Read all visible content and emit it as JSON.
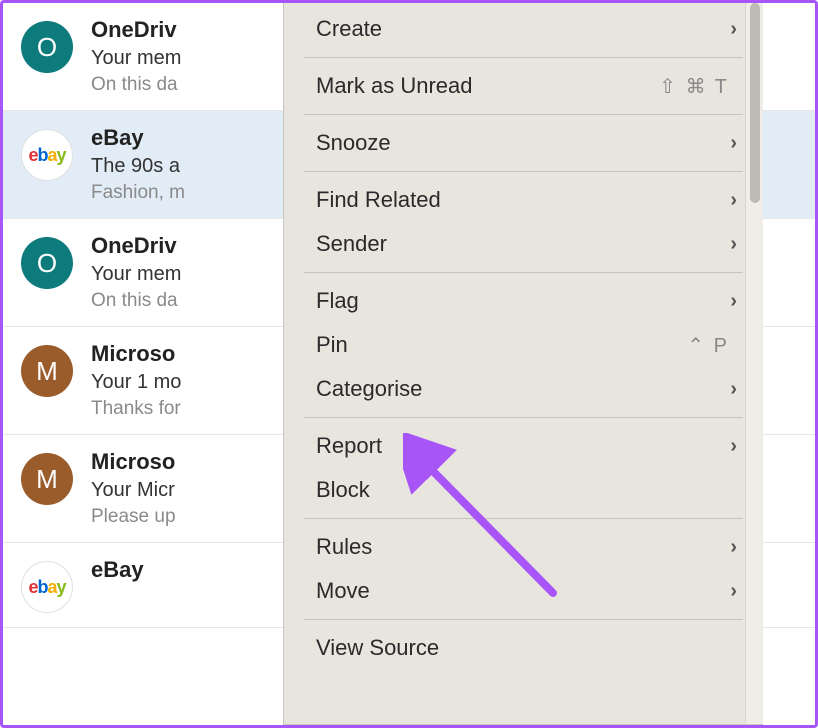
{
  "emails": [
    {
      "sender": "OneDriv",
      "avatarLetter": "O",
      "avatarClass": "teal",
      "subject": "Your mem",
      "preview": "On this da",
      "selected": false
    },
    {
      "sender": "eBay",
      "avatarLetter": "",
      "avatarClass": "ebay",
      "subject": "The 90s a",
      "preview": "Fashion, m",
      "selected": true
    },
    {
      "sender": "OneDriv",
      "avatarLetter": "O",
      "avatarClass": "teal",
      "subject": "Your mem",
      "preview": "On this da",
      "selected": false
    },
    {
      "sender": "Microso",
      "avatarLetter": "M",
      "avatarClass": "brown",
      "subject": "Your 1 mo",
      "preview": "Thanks for",
      "selected": false
    },
    {
      "sender": "Microso",
      "avatarLetter": "M",
      "avatarClass": "brown",
      "subject": "Your Micr",
      "preview": "Please up",
      "selected": false
    },
    {
      "sender": "eBay",
      "avatarLetter": "",
      "avatarClass": "ebay",
      "subject": "",
      "preview": "",
      "selected": false
    }
  ],
  "menu": {
    "create": "Create",
    "mark_unread": "Mark as Unread",
    "mark_unread_shortcut": "⇧ ⌘ T",
    "snooze": "Snooze",
    "find_related": "Find Related",
    "sender": "Sender",
    "flag": "Flag",
    "pin": "Pin",
    "pin_shortcut": "⌃ P",
    "categorise": "Categorise",
    "report": "Report",
    "block": "Block",
    "rules": "Rules",
    "move": "Move",
    "view_source": "View Source"
  },
  "annotation": {
    "target": "rules-menu-item",
    "color": "#a855f7"
  }
}
